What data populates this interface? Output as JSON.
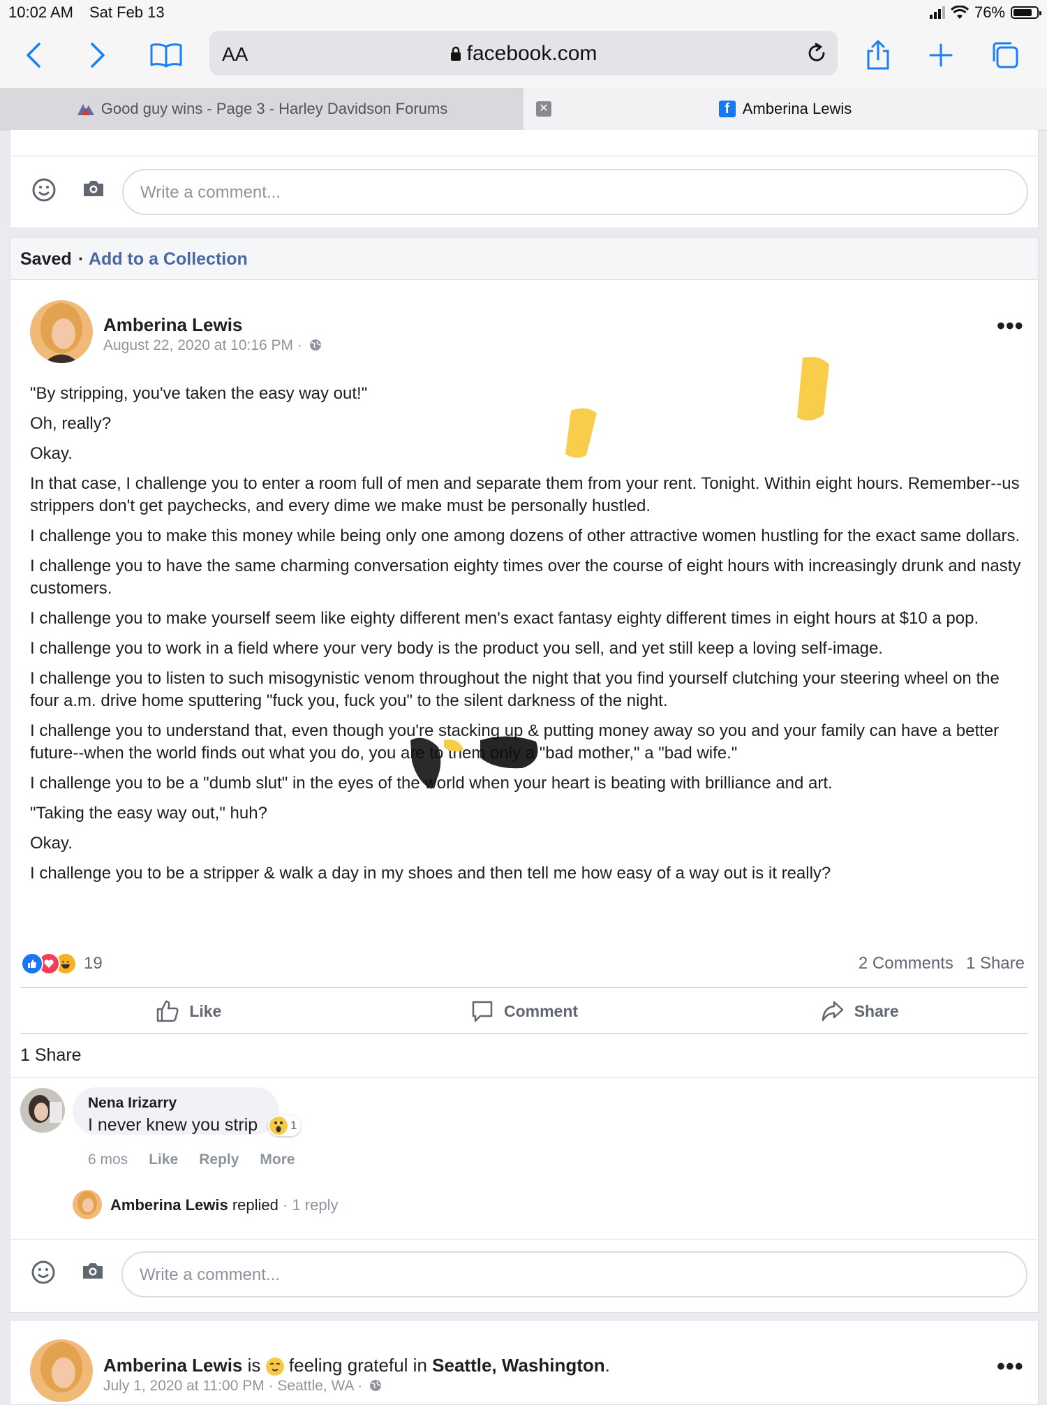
{
  "status_bar": {
    "time": "10:02 AM",
    "date": "Sat Feb 13",
    "battery": "76%"
  },
  "browser": {
    "text_size_label": "AA",
    "domain": "facebook.com",
    "tabs": [
      {
        "label": "Good guy wins - Page 3 - Harley Davidson Forums",
        "active": false
      },
      {
        "label": "Amberina Lewis",
        "active": true
      }
    ]
  },
  "comment_placeholder": "Write a comment...",
  "saved_bar": {
    "saved": "Saved",
    "separator": "·",
    "add_to_collection": "Add to a Collection"
  },
  "post": {
    "author": "Amberina Lewis",
    "date": "August 22, 2020 at 10:16 PM ·",
    "more": "•••",
    "paragraphs": [
      "\"By stripping, you've taken the easy way out!\"",
      "Oh, really?",
      "Okay.",
      "In that case, I challenge you to enter a room full of men and separate them from your rent. Tonight. Within eight hours. Remember--us strippers don't get paychecks, and every dime we make must be personally hustled.",
      "I challenge you to make this money while being only one among dozens of other attractive women hustling for the exact same dollars.",
      "I challenge you to have the same charming conversation eighty times over the course of eight hours with increasingly drunk and nasty customers.",
      "I challenge you to make yourself seem like eighty different men's exact fantasy eighty different times in eight hours at $10 a pop.",
      "I challenge you to work in a field where your very body is the product you sell, and yet still keep a loving self-image.",
      "I challenge you to listen to such misogynistic venom throughout the night that you find yourself clutching your steering wheel on the four a.m. drive home sputtering \"fuck you, fuck you\" to the silent darkness of the night.",
      "I challenge you to understand that, even though you're stacking up & putting money away so you and your family can have a better future--when the world finds out what you do, you are to them only a \"bad mother,\" a \"bad wife.\"",
      "I challenge you to be a \"dumb slut\" in the eyes of the world when your heart is beating with brilliance and art.",
      "\"Taking the easy way out,\" huh?",
      "Okay.",
      "I challenge you to be a stripper & walk a day in my shoes and then tell me how easy of a way out is it really?"
    ],
    "reaction_count": "19",
    "comments_count": "2 Comments",
    "shares_count": "1 Share",
    "actions": {
      "like": "Like",
      "comment": "Comment",
      "share": "Share"
    },
    "share_section": "1 Share",
    "comment": {
      "author": "Nena Irizarry",
      "text": "I never knew you strip",
      "reaction_count": "1",
      "age": "6 mos",
      "like": "Like",
      "reply": "Reply",
      "more": "More"
    },
    "reply": {
      "name": "Amberina Lewis",
      "verb": "replied",
      "count": "· 1 reply"
    }
  },
  "next_post": {
    "author": "Amberina Lewis",
    "is": "is",
    "feeling": "feeling grateful in",
    "place": "Seattle, Washington",
    "date": "July 1, 2020 at 11:00 PM · Seattle, WA ·",
    "more": "•••"
  },
  "colors": {
    "link_blue": "#4b67a1",
    "ios_blue": "#1a7ef5",
    "fb_blue": "#1877f2"
  }
}
